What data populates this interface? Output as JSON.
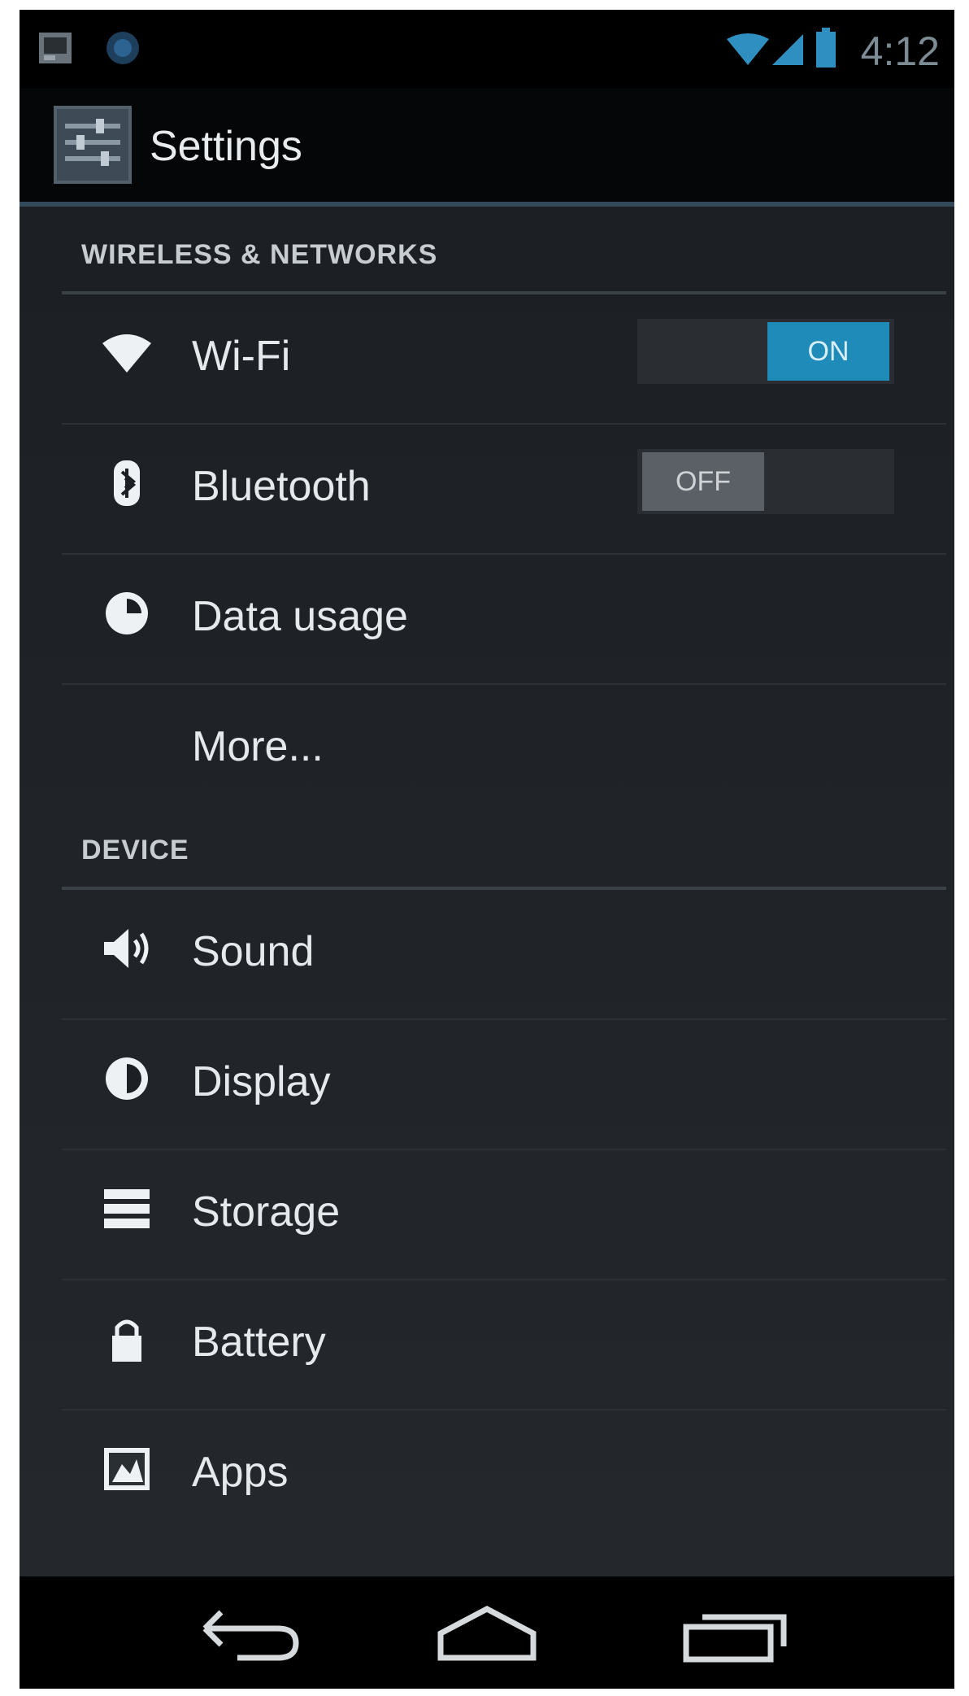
{
  "status_bar": {
    "time": "4:12",
    "icons": [
      "gallery-notification-icon",
      "sync-notification-icon",
      "wifi-signal-icon",
      "cell-signal-icon",
      "battery-icon"
    ]
  },
  "action_bar": {
    "title": "Settings",
    "icon": "settings-app-icon"
  },
  "sections": [
    {
      "header": "WIRELESS & NETWORKS",
      "items": [
        {
          "label": "Wi-Fi",
          "icon": "wifi-icon",
          "toggle": "ON"
        },
        {
          "label": "Bluetooth",
          "icon": "bluetooth-icon",
          "toggle": "OFF"
        },
        {
          "label": "Data usage",
          "icon": "data-usage-icon"
        },
        {
          "label": "More...",
          "icon": null
        }
      ]
    },
    {
      "header": "DEVICE",
      "items": [
        {
          "label": "Sound",
          "icon": "sound-icon"
        },
        {
          "label": "Display",
          "icon": "display-icon"
        },
        {
          "label": "Storage",
          "icon": "storage-icon"
        },
        {
          "label": "Battery",
          "icon": "battery-settings-icon"
        },
        {
          "label": "Apps",
          "icon": "apps-icon"
        }
      ]
    }
  ],
  "nav_bar": {
    "buttons": [
      "back-icon",
      "home-icon",
      "recent-apps-icon"
    ]
  },
  "colors": {
    "accent": "#1f8bb8",
    "background": "#1b1e22"
  }
}
